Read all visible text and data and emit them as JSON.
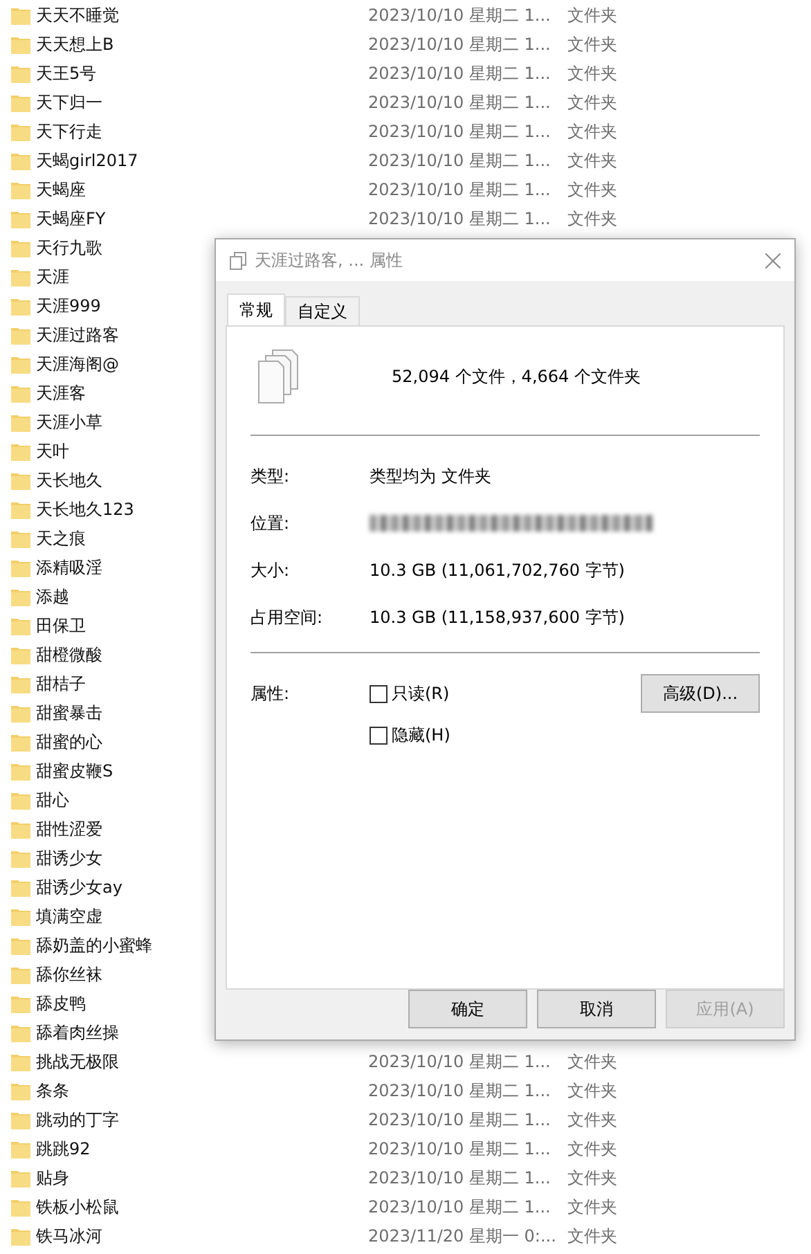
{
  "files": [
    {
      "name": "天天不睡觉",
      "date": "2023/10/10 星期二 1...",
      "type": "文件夹"
    },
    {
      "name": "天天想上B",
      "date": "2023/10/10 星期二 1...",
      "type": "文件夹"
    },
    {
      "name": "天王5号",
      "date": "2023/10/10 星期二 1...",
      "type": "文件夹"
    },
    {
      "name": "天下归一",
      "date": "2023/10/10 星期二 1...",
      "type": "文件夹"
    },
    {
      "name": "天下行走",
      "date": "2023/10/10 星期二 1...",
      "type": "文件夹"
    },
    {
      "name": "天蝎girl2017",
      "date": "2023/10/10 星期二 1...",
      "type": "文件夹"
    },
    {
      "name": "天蝎座",
      "date": "2023/10/10 星期二 1...",
      "type": "文件夹"
    },
    {
      "name": "天蝎座FY",
      "date": "2023/10/10 星期二 1...",
      "type": "文件夹"
    },
    {
      "name": "天行九歌"
    },
    {
      "name": "天涯"
    },
    {
      "name": "天涯999"
    },
    {
      "name": "天涯过路客"
    },
    {
      "name": "天涯海阁@"
    },
    {
      "name": "天涯客"
    },
    {
      "name": "天涯小草"
    },
    {
      "name": "天叶"
    },
    {
      "name": "天长地久"
    },
    {
      "name": "天长地久123"
    },
    {
      "name": "天之痕"
    },
    {
      "name": "添精吸淫"
    },
    {
      "name": "添越"
    },
    {
      "name": "田保卫"
    },
    {
      "name": "甜橙微酸"
    },
    {
      "name": "甜桔子"
    },
    {
      "name": "甜蜜暴击"
    },
    {
      "name": "甜蜜的心"
    },
    {
      "name": "甜蜜皮鞭S"
    },
    {
      "name": "甜心"
    },
    {
      "name": "甜性涩爱"
    },
    {
      "name": "甜诱少女"
    },
    {
      "name": "甜诱少女ay"
    },
    {
      "name": "填满空虚"
    },
    {
      "name": "舔奶盖的小蜜蜂"
    },
    {
      "name": "舔你丝袜"
    },
    {
      "name": "舔皮鸭"
    },
    {
      "name": "舔着肉丝操"
    },
    {
      "name": "挑战无极限",
      "date": "2023/10/10 星期二 1...",
      "type": "文件夹"
    },
    {
      "name": "条条",
      "date": "2023/10/10 星期二 1...",
      "type": "文件夹"
    },
    {
      "name": "跳动的丁字",
      "date": "2023/10/10 星期二 1...",
      "type": "文件夹"
    },
    {
      "name": "跳跳92",
      "date": "2023/10/10 星期二 1...",
      "type": "文件夹"
    },
    {
      "name": "贴身",
      "date": "2023/10/10 星期二 1...",
      "type": "文件夹"
    },
    {
      "name": "铁板小松鼠",
      "date": "2023/10/10 星期二 1...",
      "type": "文件夹"
    },
    {
      "name": "铁马冰河",
      "date": "2023/11/20 星期一 0:...",
      "type": "文件夹"
    }
  ],
  "dialog": {
    "title": "天涯过路客, ... 属性",
    "tabs": [
      {
        "label": "常规",
        "selected": true
      },
      {
        "label": "自定义",
        "selected": false
      }
    ],
    "summary": "52,094 个文件，4,664 个文件夹",
    "properties": [
      {
        "label": "类型:",
        "value": "类型均为 文件夹"
      },
      {
        "label": "位置:",
        "kind": "blurred"
      },
      {
        "label": "大小:",
        "value": "10.3 GB (11,061,702,760 字节)"
      },
      {
        "label": "占用空间:",
        "value": "10.3 GB (11,158,937,600 字节)"
      }
    ],
    "attributes_label": "属性:",
    "attributes": [
      {
        "label": "只读(R)",
        "checked": false
      },
      {
        "label": "隐藏(H)",
        "checked": false
      }
    ],
    "advanced_button": "高级(D)...",
    "buttons": [
      {
        "label": "确定",
        "disabled": false
      },
      {
        "label": "取消",
        "disabled": false
      },
      {
        "label": "应用(A)",
        "disabled": true
      }
    ]
  }
}
